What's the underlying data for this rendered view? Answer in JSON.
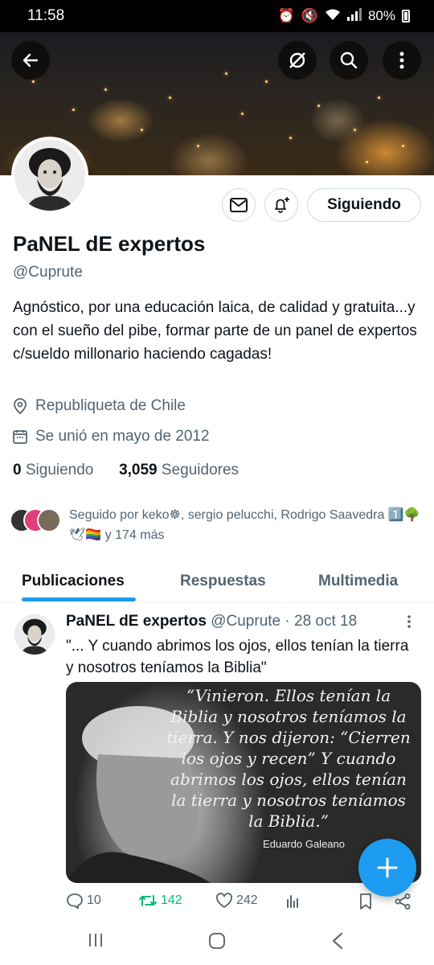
{
  "status_bar": {
    "time": "11:58",
    "battery": "80%"
  },
  "profile": {
    "name": "PaNEL dE expertos",
    "handle": "@Cuprute",
    "bio": "Agnóstico,  por una educación laica, de calidad y gratuita...y con el sueño del pibe, formar parte de un panel de expertos c/sueldo millonario haciendo cagadas!",
    "location": "Republiqueta de Chile",
    "joined": "Se unió en mayo de 2012",
    "following_count": "0",
    "following_label": "Siguiendo",
    "followers_count": "3,059",
    "followers_label": "Seguidores",
    "follow_button": "Siguiendo",
    "followed_by": "Seguido por keko☸, sergio pelucchi, Rodrigo Saavedra 1️⃣🌳🕊🏳️‍🌈 y 174 más"
  },
  "tabs": [
    {
      "label": "Publicaciones",
      "active": true
    },
    {
      "label": "Respuestas",
      "active": false
    },
    {
      "label": "Multimedia",
      "active": false
    }
  ],
  "tweet": {
    "author": "PaNEL dE expertos",
    "handle": "@Cuprute",
    "date": "· 28 oct 18",
    "text": "\"... Y cuando abrimos los ojos, ellos tenían la tierra y nosotros teníamos la Biblia\"",
    "image_quote": "“Vinieron. Ellos tenían la Biblia y nosotros teníamos la tierra. Y nos dijeron: “Cierren los ojos y recen” Y cuando abrimos los ojos, ellos tenían la tierra y nosotros teníamos la Biblia.”",
    "image_author": "Eduardo Galeano",
    "replies": "10",
    "retweets": "142",
    "likes": "242"
  },
  "colors": {
    "accent": "#1d9bf0",
    "retweet": "#00ba7c",
    "muted": "#536471"
  }
}
